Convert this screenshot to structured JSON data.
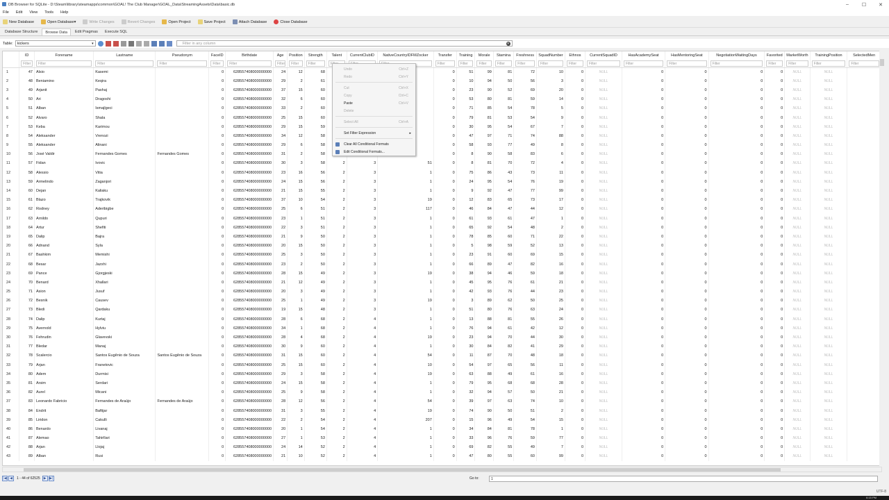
{
  "window": {
    "title": "DB Browser for SQLite - D:\\Steam\\library\\steamapps\\common\\GOAL! The Club Manager\\GOAL_Data\\StreamingAssets\\Data\\basic.db",
    "minimize": "–",
    "maximize": "☐",
    "close": "✕"
  },
  "menu": [
    "File",
    "Edit",
    "View",
    "Tools",
    "Help"
  ],
  "toolbar": {
    "new_db": "New Database",
    "open_db": "Open Database",
    "write": "Write Changes",
    "revert": "Revert Changes",
    "open_project": "Open Project",
    "save_project": "Save Project",
    "attach": "Attach Database",
    "close_db": "Close Database"
  },
  "tabs": [
    "Database Structure",
    "Browse Data",
    "Edit Pragmas",
    "Execute SQL"
  ],
  "table_bar": {
    "label": "Table:",
    "selected_table": "kickers",
    "filter_placeholder": "Filter in any column"
  },
  "filter_placeholder": "Filter",
  "columns": [
    "ID",
    "Forename",
    "Lastname",
    "Pseudonym",
    "FaceID",
    "Birthdate",
    "Age",
    "Position",
    "Strength",
    "Talent",
    "CurrentClubID",
    "NativeCountryIDFMZocker",
    "Transfer",
    "Training",
    "Morale",
    "Stamina",
    "Freshness",
    "SquadNumber",
    "Ethnos",
    "CurrentSquadID",
    "HasAcademySeat",
    "HasMentoringSeat",
    "NegotiationWaitingDays",
    "Favorited",
    "MarketWorth",
    "TrainingPosition",
    "SelectedMen"
  ],
  "null_text": "NULL",
  "rows": [
    [
      "1",
      "47",
      "Alsio",
      "Kasemi",
      "",
      "0",
      "628557408000000000",
      "24",
      "12",
      "68",
      "2",
      "",
      "",
      "0",
      "51",
      "99",
      "81",
      "72",
      "10",
      "0",
      "NULL",
      "0",
      "0",
      "0",
      "0",
      "NULL",
      "NULL",
      ""
    ],
    [
      "2",
      "48",
      "Beniamino",
      "Keqira",
      "",
      "0",
      "628557408000000000",
      "29",
      "2",
      "61",
      "2",
      "",
      "",
      "0",
      "10",
      "94",
      "50",
      "56",
      "3",
      "0",
      "NULL",
      "0",
      "0",
      "0",
      "0",
      "NULL",
      "NULL",
      ""
    ],
    [
      "3",
      "49",
      "Arjanit",
      "Pashaj",
      "",
      "0",
      "628557408000000000",
      "37",
      "15",
      "60",
      "2",
      "",
      "",
      "0",
      "23",
      "90",
      "52",
      "69",
      "20",
      "0",
      "NULL",
      "0",
      "0",
      "0",
      "0",
      "NULL",
      "NULL",
      ""
    ],
    [
      "4",
      "50",
      "Ari",
      "Dragoshi",
      "",
      "0",
      "628557408000000000",
      "32",
      "6",
      "60",
      "2",
      "",
      "",
      "0",
      "53",
      "80",
      "81",
      "59",
      "14",
      "0",
      "NULL",
      "0",
      "0",
      "0",
      "0",
      "NULL",
      "NULL",
      ""
    ],
    [
      "5",
      "51",
      "Alban",
      "Ismajlgeci",
      "",
      "0",
      "628557408000000000",
      "33",
      "2",
      "60",
      "2",
      "",
      "",
      "0",
      "71",
      "85",
      "54",
      "78",
      "5",
      "0",
      "NULL",
      "0",
      "0",
      "0",
      "0",
      "NULL",
      "NULL",
      ""
    ],
    [
      "6",
      "52",
      "Alvaro",
      "Shala",
      "",
      "0",
      "628557408000000000",
      "25",
      "15",
      "60",
      "2",
      "",
      "",
      "0",
      "79",
      "81",
      "53",
      "54",
      "9",
      "0",
      "NULL",
      "0",
      "0",
      "0",
      "0",
      "NULL",
      "NULL",
      ""
    ],
    [
      "7",
      "53",
      "Keba",
      "Karimou",
      "",
      "0",
      "628557408000000000",
      "29",
      "15",
      "59",
      "2",
      "",
      "",
      "0",
      "30",
      "95",
      "54",
      "67",
      "7",
      "0",
      "NULL",
      "0",
      "0",
      "0",
      "0",
      "NULL",
      "NULL",
      ""
    ],
    [
      "8",
      "54",
      "Aleksander",
      "Vrenozi",
      "",
      "0",
      "628557408000000000",
      "34",
      "12",
      "58",
      "2",
      "",
      "",
      "0",
      "47",
      "97",
      "71",
      "74",
      "88",
      "0",
      "NULL",
      "0",
      "0",
      "0",
      "0",
      "NULL",
      "NULL",
      ""
    ],
    [
      "9",
      "55",
      "Aleksander",
      "Alinani",
      "",
      "0",
      "628557408000000000",
      "29",
      "6",
      "58",
      "2",
      "",
      "",
      "0",
      "58",
      "93",
      "77",
      "49",
      "8",
      "0",
      "NULL",
      "0",
      "0",
      "0",
      "0",
      "NULL",
      "NULL",
      ""
    ],
    [
      "10",
      "56",
      "José Valdir",
      "Fernandes Gomes",
      "Fernandes Gomes",
      "0",
      "628557408000000000",
      "31",
      "2",
      "58",
      "2",
      "",
      "",
      "0",
      "8",
      "90",
      "58",
      "83",
      "6",
      "0",
      "NULL",
      "0",
      "0",
      "0",
      "0",
      "NULL",
      "NULL",
      ""
    ],
    [
      "11",
      "57",
      "Fidan",
      "Ivovic",
      "",
      "0",
      "628557408000000000",
      "30",
      "3",
      "58",
      "2",
      "3",
      "51",
      "0",
      "8",
      "81",
      "70",
      "72",
      "4",
      "0",
      "NULL",
      "0",
      "0",
      "0",
      "0",
      "NULL",
      "NULL",
      ""
    ],
    [
      "12",
      "58",
      "Alessio",
      "Vitia",
      "",
      "0",
      "628557408000000000",
      "23",
      "16",
      "56",
      "2",
      "3",
      "1",
      "0",
      "75",
      "86",
      "43",
      "73",
      "11",
      "0",
      "NULL",
      "0",
      "0",
      "0",
      "0",
      "NULL",
      "NULL",
      ""
    ],
    [
      "13",
      "59",
      "Armelindo",
      "Zaganjori",
      "",
      "0",
      "628557408000000000",
      "24",
      "15",
      "56",
      "2",
      "3",
      "1",
      "0",
      "24",
      "95",
      "54",
      "76",
      "19",
      "0",
      "NULL",
      "0",
      "0",
      "0",
      "0",
      "NULL",
      "NULL",
      ""
    ],
    [
      "14",
      "60",
      "Dejan",
      "Kaliaku",
      "",
      "0",
      "628557408000000000",
      "21",
      "15",
      "55",
      "2",
      "3",
      "1",
      "0",
      "9",
      "92",
      "47",
      "77",
      "99",
      "0",
      "NULL",
      "0",
      "0",
      "0",
      "0",
      "NULL",
      "NULL",
      ""
    ],
    [
      "15",
      "61",
      "Blazo",
      "Trajkovik",
      "",
      "0",
      "628557408000000000",
      "37",
      "10",
      "54",
      "2",
      "3",
      "19",
      "0",
      "12",
      "83",
      "65",
      "73",
      "17",
      "0",
      "NULL",
      "0",
      "0",
      "0",
      "0",
      "NULL",
      "NULL",
      ""
    ],
    [
      "16",
      "62",
      "Rodney",
      "Aderibigbe",
      "",
      "0",
      "628557408000000000",
      "25",
      "6",
      "51",
      "2",
      "3",
      "117",
      "0",
      "46",
      "84",
      "47",
      "44",
      "12",
      "0",
      "NULL",
      "0",
      "0",
      "0",
      "0",
      "NULL",
      "NULL",
      ""
    ],
    [
      "17",
      "63",
      "Arnildo",
      "Qupuri",
      "",
      "0",
      "628557408000000000",
      "23",
      "1",
      "51",
      "2",
      "3",
      "1",
      "0",
      "61",
      "93",
      "61",
      "47",
      "1",
      "0",
      "NULL",
      "0",
      "0",
      "0",
      "0",
      "NULL",
      "NULL",
      ""
    ],
    [
      "18",
      "64",
      "Artur",
      "Shefiti",
      "",
      "0",
      "628557408000000000",
      "22",
      "3",
      "51",
      "2",
      "3",
      "1",
      "0",
      "65",
      "92",
      "54",
      "48",
      "2",
      "0",
      "NULL",
      "0",
      "0",
      "0",
      "0",
      "NULL",
      "NULL",
      ""
    ],
    [
      "19",
      "65",
      "Dalip",
      "Bajra",
      "",
      "0",
      "628557408000000000",
      "21",
      "9",
      "50",
      "2",
      "3",
      "1",
      "0",
      "78",
      "85",
      "60",
      "71",
      "22",
      "0",
      "NULL",
      "0",
      "0",
      "0",
      "0",
      "NULL",
      "NULL",
      ""
    ],
    [
      "20",
      "66",
      "Adnand",
      "Syla",
      "",
      "0",
      "628557408000000000",
      "20",
      "15",
      "50",
      "2",
      "3",
      "1",
      "0",
      "5",
      "98",
      "59",
      "52",
      "13",
      "0",
      "NULL",
      "0",
      "0",
      "0",
      "0",
      "NULL",
      "NULL",
      ""
    ],
    [
      "21",
      "67",
      "Bashkim",
      "Memishi",
      "",
      "0",
      "628557408000000000",
      "25",
      "3",
      "50",
      "2",
      "3",
      "1",
      "0",
      "23",
      "91",
      "60",
      "69",
      "15",
      "0",
      "NULL",
      "0",
      "0",
      "0",
      "0",
      "NULL",
      "NULL",
      ""
    ],
    [
      "22",
      "68",
      "Besar",
      "Jazxhi",
      "",
      "0",
      "628557408000000000",
      "23",
      "2",
      "50",
      "2",
      "3",
      "1",
      "0",
      "66",
      "89",
      "47",
      "82",
      "16",
      "0",
      "NULL",
      "0",
      "0",
      "0",
      "0",
      "NULL",
      "NULL",
      ""
    ],
    [
      "23",
      "69",
      "Pance",
      "Gjorgjeski",
      "",
      "0",
      "628557408000000000",
      "28",
      "15",
      "49",
      "2",
      "3",
      "19",
      "0",
      "38",
      "94",
      "46",
      "59",
      "18",
      "0",
      "NULL",
      "0",
      "0",
      "0",
      "0",
      "NULL",
      "NULL",
      ""
    ],
    [
      "24",
      "70",
      "Benard",
      "Xhallari",
      "",
      "0",
      "628557408000000000",
      "21",
      "12",
      "49",
      "2",
      "3",
      "1",
      "0",
      "45",
      "95",
      "76",
      "61",
      "21",
      "0",
      "NULL",
      "0",
      "0",
      "0",
      "0",
      "NULL",
      "NULL",
      ""
    ],
    [
      "25",
      "71",
      "Asion",
      "Jusuf",
      "",
      "0",
      "628557408000000000",
      "20",
      "3",
      "49",
      "2",
      "3",
      "1",
      "0",
      "42",
      "93",
      "76",
      "44",
      "23",
      "0",
      "NULL",
      "0",
      "0",
      "0",
      "0",
      "NULL",
      "NULL",
      ""
    ],
    [
      "26",
      "72",
      "Besnik",
      "Causev",
      "",
      "0",
      "628557408000000000",
      "25",
      "1",
      "49",
      "2",
      "3",
      "19",
      "0",
      "3",
      "89",
      "62",
      "50",
      "25",
      "0",
      "NULL",
      "0",
      "0",
      "0",
      "0",
      "NULL",
      "NULL",
      ""
    ],
    [
      "27",
      "73",
      "Bledi",
      "Qardaku",
      "",
      "0",
      "628557408000000000",
      "19",
      "15",
      "48",
      "2",
      "3",
      "1",
      "0",
      "51",
      "80",
      "76",
      "63",
      "24",
      "0",
      "NULL",
      "0",
      "0",
      "0",
      "0",
      "NULL",
      "NULL",
      ""
    ],
    [
      "28",
      "74",
      "Dalip",
      "Kurtaj",
      "",
      "0",
      "628557408000000000",
      "28",
      "6",
      "68",
      "2",
      "4",
      "1",
      "0",
      "13",
      "88",
      "81",
      "55",
      "26",
      "0",
      "NULL",
      "0",
      "0",
      "0",
      "0",
      "NULL",
      "NULL",
      ""
    ],
    [
      "29",
      "75",
      "Avernold",
      "Hylviu",
      "",
      "0",
      "628557408000000000",
      "34",
      "1",
      "68",
      "2",
      "4",
      "1",
      "0",
      "76",
      "94",
      "61",
      "42",
      "12",
      "0",
      "NULL",
      "0",
      "0",
      "0",
      "0",
      "NULL",
      "NULL",
      ""
    ],
    [
      "30",
      "76",
      "Fehrudin",
      "Glavevski",
      "",
      "0",
      "628557408000000000",
      "28",
      "4",
      "68",
      "2",
      "4",
      "19",
      "0",
      "23",
      "94",
      "70",
      "44",
      "30",
      "0",
      "NULL",
      "0",
      "0",
      "0",
      "0",
      "NULL",
      "NULL",
      ""
    ],
    [
      "31",
      "77",
      "Bledar",
      "Manaj",
      "",
      "0",
      "628557408000000000",
      "30",
      "9",
      "60",
      "2",
      "4",
      "1",
      "0",
      "30",
      "84",
      "82",
      "41",
      "29",
      "0",
      "NULL",
      "0",
      "0",
      "0",
      "0",
      "NULL",
      "NULL",
      ""
    ],
    [
      "32",
      "78",
      "Scalercio",
      "Santos Eugênio de Souza",
      "Santos Eugênio de Souza",
      "0",
      "628557408000000000",
      "31",
      "15",
      "60",
      "2",
      "4",
      "54",
      "0",
      "11",
      "87",
      "70",
      "48",
      "18",
      "0",
      "NULL",
      "0",
      "0",
      "0",
      "0",
      "NULL",
      "NULL",
      ""
    ],
    [
      "33",
      "79",
      "Arjan",
      "Franetovic",
      "",
      "0",
      "628557408000000000",
      "25",
      "15",
      "60",
      "2",
      "4",
      "10",
      "0",
      "54",
      "97",
      "65",
      "56",
      "11",
      "0",
      "NULL",
      "0",
      "0",
      "0",
      "0",
      "NULL",
      "NULL",
      ""
    ],
    [
      "34",
      "80",
      "Adem",
      "Durmisi",
      "",
      "0",
      "628557408000000000",
      "29",
      "3",
      "58",
      "2",
      "4",
      "19",
      "0",
      "63",
      "88",
      "49",
      "61",
      "16",
      "0",
      "NULL",
      "0",
      "0",
      "0",
      "0",
      "NULL",
      "NULL",
      ""
    ],
    [
      "35",
      "81",
      "Arsim",
      "Serdari",
      "",
      "0",
      "628557408000000000",
      "24",
      "15",
      "58",
      "2",
      "4",
      "1",
      "0",
      "79",
      "95",
      "68",
      "68",
      "28",
      "0",
      "NULL",
      "0",
      "0",
      "0",
      "0",
      "NULL",
      "NULL",
      ""
    ],
    [
      "36",
      "82",
      "Aurel",
      "Micani",
      "",
      "0",
      "628557408000000000",
      "25",
      "9",
      "58",
      "2",
      "4",
      "1",
      "0",
      "32",
      "94",
      "57",
      "50",
      "21",
      "0",
      "NULL",
      "0",
      "0",
      "0",
      "0",
      "NULL",
      "NULL",
      ""
    ],
    [
      "37",
      "83",
      "Leonardo Fabricio",
      "Fernandes de Araújo",
      "Fernandes de Araújo",
      "0",
      "628557408000000000",
      "28",
      "12",
      "56",
      "2",
      "4",
      "54",
      "0",
      "39",
      "97",
      "63",
      "74",
      "10",
      "0",
      "NULL",
      "0",
      "0",
      "0",
      "0",
      "NULL",
      "NULL",
      ""
    ],
    [
      "38",
      "84",
      "Endrit",
      "Baftijar",
      "",
      "0",
      "628557408000000000",
      "31",
      "3",
      "55",
      "2",
      "4",
      "19",
      "0",
      "74",
      "90",
      "50",
      "51",
      "2",
      "0",
      "NULL",
      "0",
      "0",
      "0",
      "0",
      "NULL",
      "NULL",
      ""
    ],
    [
      "39",
      "85",
      "Liridon",
      "Cakulli",
      "",
      "0",
      "628557408000000000",
      "22",
      "2",
      "54",
      "2",
      "4",
      "207",
      "0",
      "15",
      "96",
      "49",
      "54",
      "15",
      "0",
      "NULL",
      "0",
      "0",
      "0",
      "0",
      "NULL",
      "NULL",
      ""
    ],
    [
      "40",
      "86",
      "Benardo",
      "Livanaj",
      "",
      "0",
      "628557408000000000",
      "20",
      "1",
      "54",
      "2",
      "4",
      "1",
      "0",
      "34",
      "84",
      "81",
      "78",
      "1",
      "0",
      "NULL",
      "0",
      "0",
      "0",
      "0",
      "NULL",
      "NULL",
      ""
    ],
    [
      "41",
      "87",
      "Alemao",
      "Tahirllari",
      "",
      "0",
      "628557408000000000",
      "27",
      "1",
      "53",
      "2",
      "4",
      "1",
      "0",
      "33",
      "96",
      "76",
      "59",
      "77",
      "0",
      "NULL",
      "0",
      "0",
      "0",
      "0",
      "NULL",
      "NULL",
      ""
    ],
    [
      "42",
      "88",
      "Arjan",
      "Llojaj",
      "",
      "0",
      "628557408000000000",
      "24",
      "14",
      "52",
      "2",
      "4",
      "1",
      "0",
      "69",
      "82",
      "55",
      "49",
      "7",
      "0",
      "NULL",
      "0",
      "0",
      "0",
      "0",
      "NULL",
      "NULL",
      ""
    ],
    [
      "43",
      "89",
      "Alban",
      "Rusi",
      "",
      "0",
      "628557408000000000",
      "21",
      "10",
      "52",
      "2",
      "4",
      "1",
      "0",
      "47",
      "80",
      "55",
      "60",
      "99",
      "0",
      "NULL",
      "0",
      "0",
      "0",
      "0",
      "NULL",
      "NULL",
      ""
    ]
  ],
  "context_menu": [
    {
      "label": "Undo",
      "shortcut": "Ctrl+Z",
      "disabled": true
    },
    {
      "label": "Redo",
      "shortcut": "Ctrl+Y",
      "disabled": true
    },
    {
      "sep": true
    },
    {
      "label": "Cut",
      "shortcut": "Ctrl+X",
      "disabled": true
    },
    {
      "label": "Copy",
      "shortcut": "Ctrl+C",
      "disabled": true
    },
    {
      "label": "Paste",
      "shortcut": "Ctrl+V",
      "disabled": false
    },
    {
      "label": "Delete",
      "shortcut": "",
      "disabled": true
    },
    {
      "sep": true
    },
    {
      "label": "Select All",
      "shortcut": "Ctrl+A",
      "disabled": true
    },
    {
      "sep": true
    },
    {
      "label": "Set Filter Expression",
      "shortcut": "",
      "disabled": false,
      "submenu": true
    },
    {
      "sep": true
    },
    {
      "label": "Clear All Conditional Formats",
      "shortcut": "",
      "disabled": false,
      "icon": true
    },
    {
      "label": "Edit Conditional Formats...",
      "shortcut": "",
      "disabled": false,
      "icon": true
    }
  ],
  "navigation": {
    "first": "|◀",
    "prev": "◀",
    "next": "▶",
    "last": "▶|",
    "record_count": "1 - 44 of 62525",
    "goto_label": "Go to:",
    "goto_value": "1"
  },
  "status": {
    "encoding": "UTF-8"
  },
  "taskbar": {
    "time": "6:15 PM"
  }
}
